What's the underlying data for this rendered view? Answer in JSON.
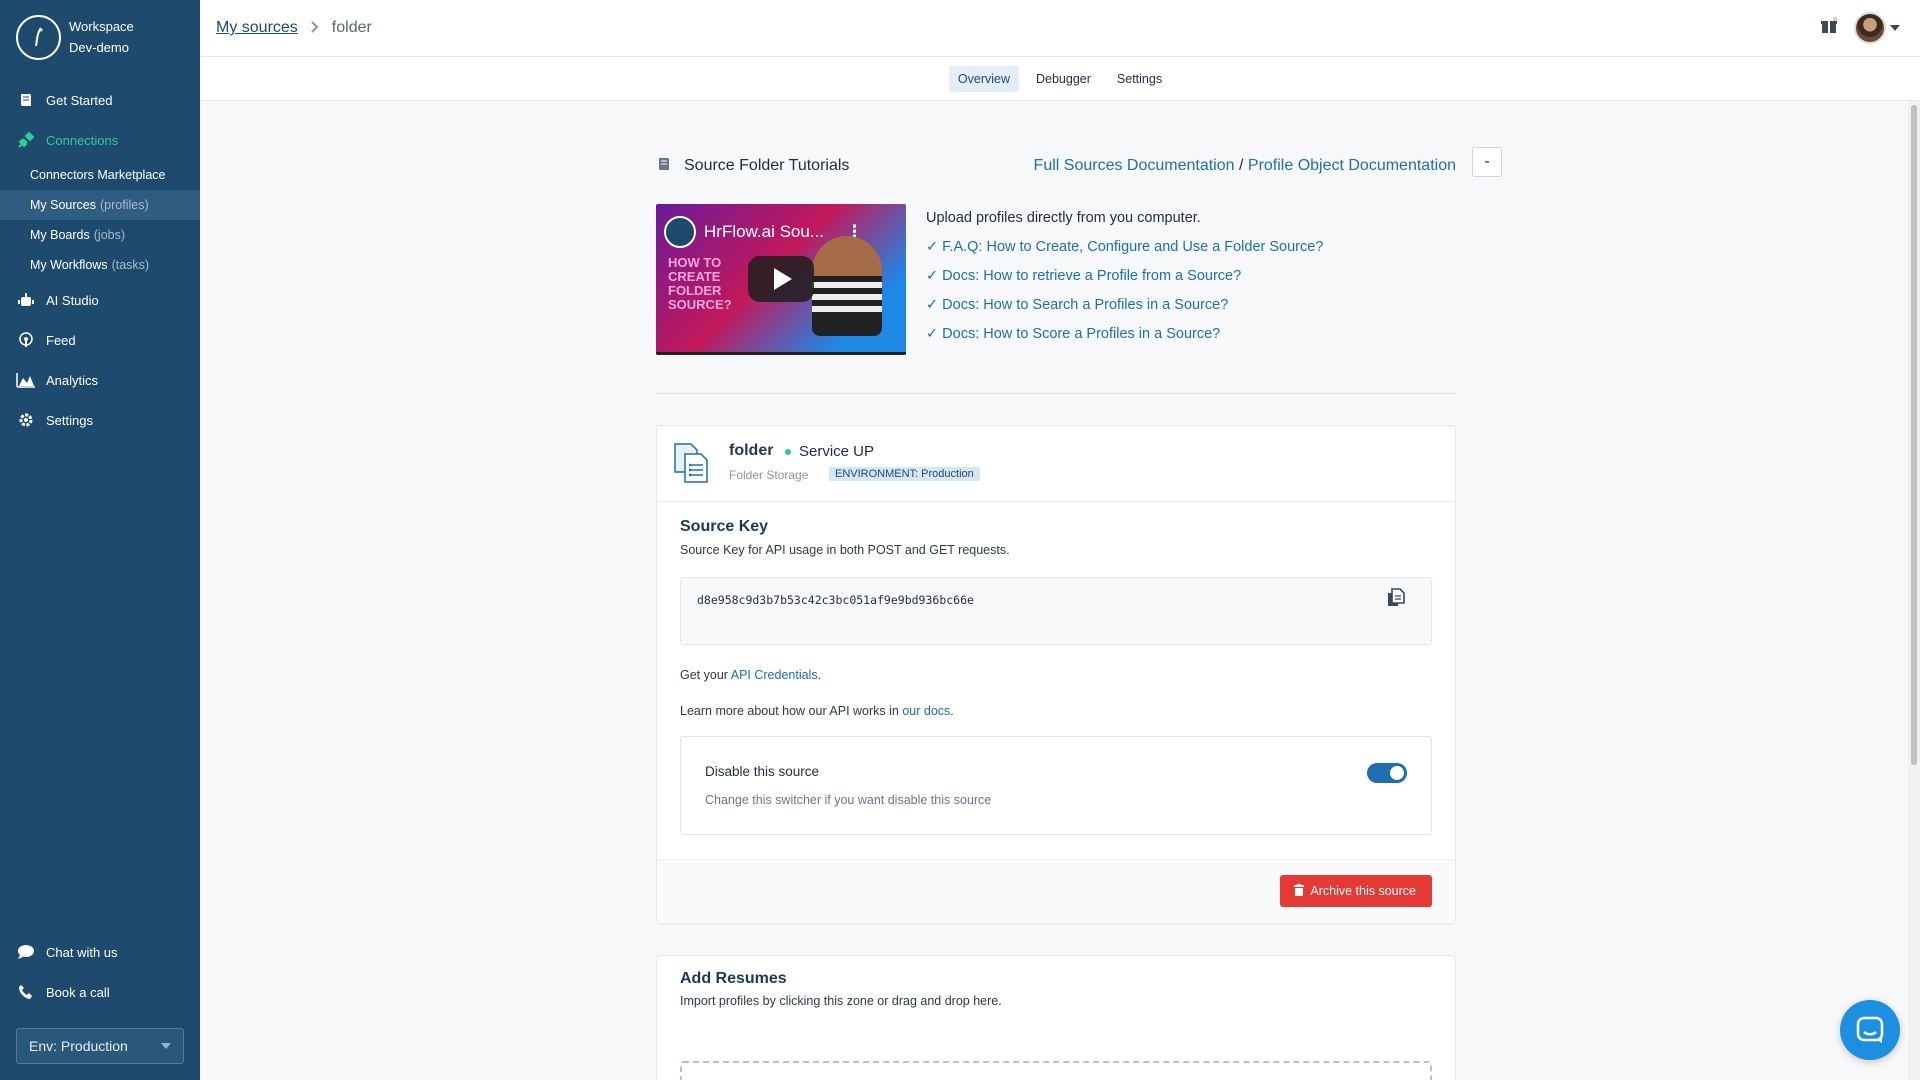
{
  "workspace": {
    "label": "Workspace",
    "name": "Dev-demo"
  },
  "sidebar": {
    "items": [
      {
        "label": "Get Started",
        "icon": "book-icon"
      },
      {
        "label": "Connections",
        "icon": "plug-icon",
        "active": true
      },
      {
        "label": "AI Studio",
        "icon": "robot-icon"
      },
      {
        "label": "Feed",
        "icon": "podcast-icon"
      },
      {
        "label": "Analytics",
        "icon": "chart-area-icon"
      },
      {
        "label": "Settings",
        "icon": "gear-icon"
      }
    ],
    "sub_items": [
      {
        "label": "Connectors Marketplace",
        "muted": ""
      },
      {
        "label": "My Sources",
        "muted": "(profiles)"
      },
      {
        "label": "My Boards",
        "muted": "(jobs)"
      },
      {
        "label": "My Workflows",
        "muted": "(tasks)"
      }
    ],
    "bottom": [
      {
        "label": "Chat with us",
        "icon": "chat-bubble-icon"
      },
      {
        "label": "Book a call",
        "icon": "phone-icon"
      }
    ],
    "env_select": "Env: Production"
  },
  "breadcrumb": {
    "parent": "My sources",
    "current": "folder"
  },
  "tabs": [
    "Overview",
    "Debugger",
    "Settings"
  ],
  "tutorials": {
    "title": "Source Folder Tutorials",
    "doc_link_1": "Full Sources Documentation",
    "separator": "/",
    "doc_link_2": "Profile Object Documentation",
    "collapse_label": "-",
    "video_title": "HrFlow.ai Sou...",
    "video_caption": "HOW TO CREATE FOLDER SOURCE?",
    "intro": "Upload profiles directly from you computer.",
    "links": [
      "✓ F.A.Q: How to Create, Configure and Use a Folder Source?",
      "✓ Docs: How to retrieve a Profile from a Source?",
      "✓ Docs: How to Search a Profiles in a Source?",
      "✓ Docs: How to Score a Profiles in a Source?"
    ]
  },
  "source": {
    "name": "folder",
    "status": "Service UP",
    "type": "Folder Storage",
    "environment": "ENVIRONMENT: Production",
    "key_title": "Source Key",
    "key_subtitle": "Source Key for API usage in both POST and GET requests.",
    "key_value": "d8e958c9d3b7b53c42c3bc051af9e9bd936bc66e",
    "credentials_prefix": "Get your ",
    "credentials_link": "API Credentials",
    "credentials_suffix": ".",
    "docs_prefix": "Learn more about how our API works in ",
    "docs_link": "our docs",
    "docs_suffix": ".",
    "disable_title": "Disable this source",
    "disable_subtitle": "Change this switcher if you want disable this source",
    "archive_label": "Archive this source"
  },
  "resumes": {
    "title": "Add Resumes",
    "subtitle": "Import profiles by clicking this zone or drag and drop here."
  },
  "colors": {
    "sidebar": "#1d4a6d",
    "accent": "#2ecc8f",
    "link": "#1d6fb0",
    "danger": "#e53935"
  }
}
